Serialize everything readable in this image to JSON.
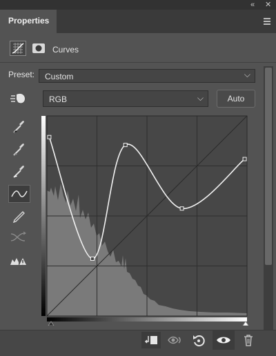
{
  "panel": {
    "title": "Properties",
    "header_title": "Curves",
    "window_buttons": {
      "collapse": "«",
      "close": "✕"
    }
  },
  "preset": {
    "label": "Preset:",
    "value": "Custom"
  },
  "channel": {
    "value": "RGB"
  },
  "auto_button": "Auto",
  "left_tools": [
    "targeted-adjustment-icon",
    "black-point-eyedropper-icon",
    "gray-point-eyedropper-icon",
    "white-point-eyedropper-icon",
    "edit-curve-points-icon",
    "draw-curve-pencil-icon",
    "smooth-curve-icon",
    "clipping-warning-icon"
  ],
  "curve_points": [
    {
      "input": 3,
      "output": 228
    },
    {
      "input": 58,
      "output": 73
    },
    {
      "input": 100,
      "output": 218
    },
    {
      "input": 172,
      "output": 137
    },
    {
      "input": 252,
      "output": 200
    }
  ],
  "bottom_actions": [
    "clip-to-layer-icon",
    "view-previous-state-icon",
    "reset-icon",
    "visibility-eye-icon",
    "delete-trash-icon"
  ],
  "colors": {
    "panel": "#535353",
    "graph_bg": "#474747",
    "histogram": "#787878",
    "curve": "#f2f2f2"
  }
}
